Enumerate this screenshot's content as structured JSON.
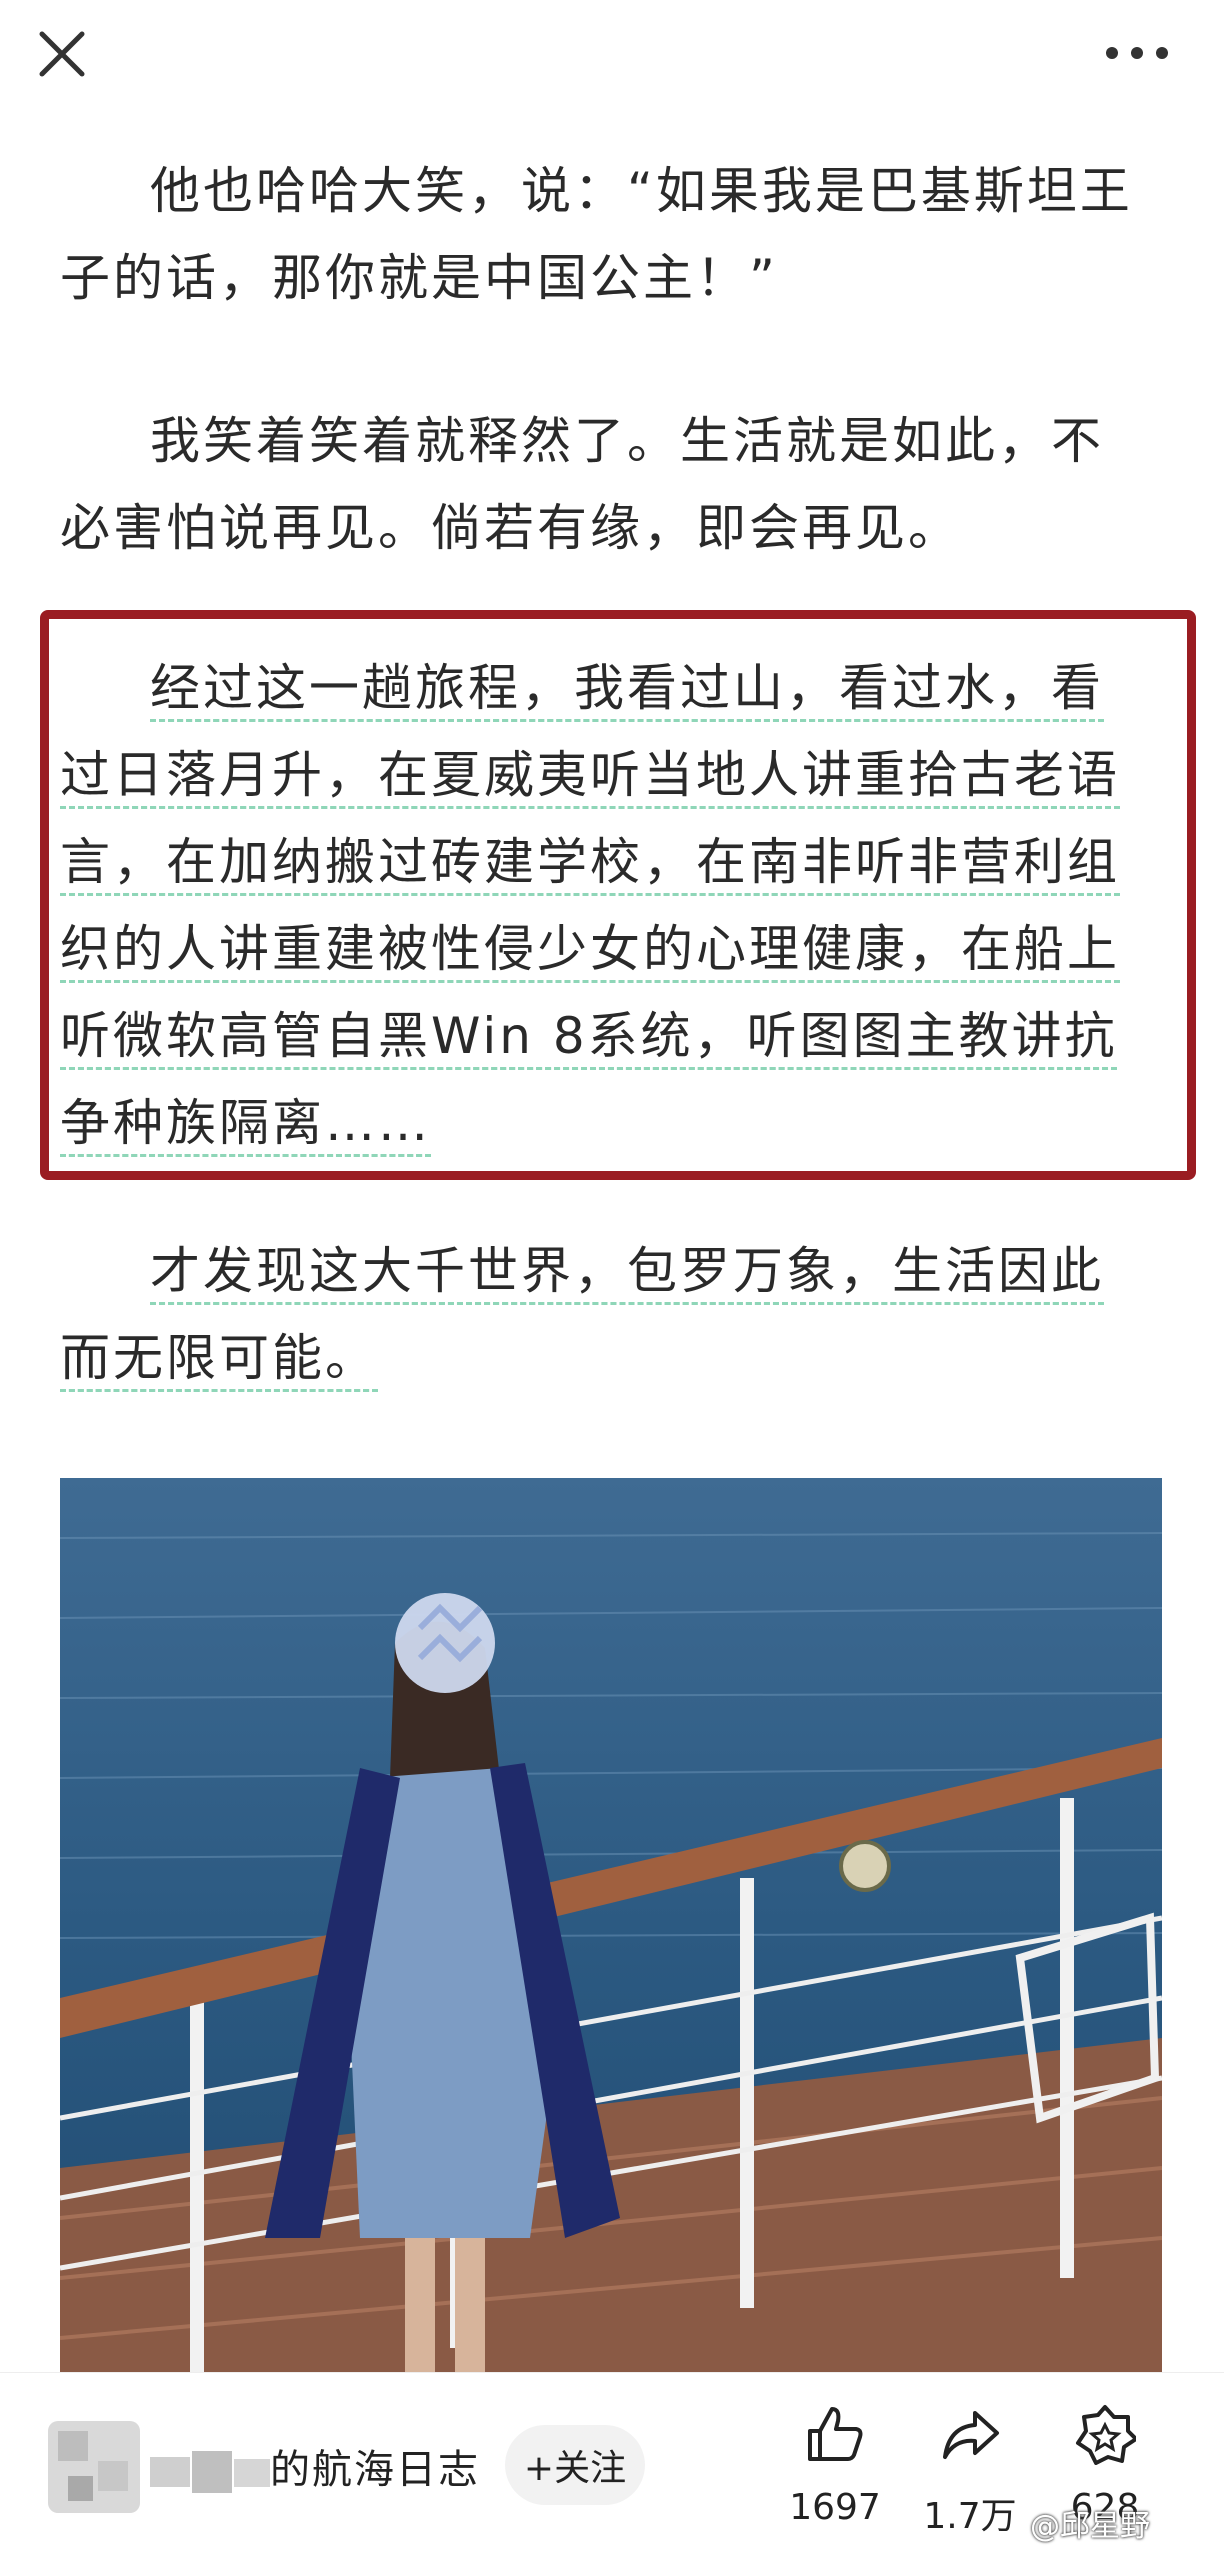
{
  "header": {
    "close_icon": "close-icon",
    "more_icon": "more-icon"
  },
  "article": {
    "para1": {
      "line1": "他也哈哈大笑，说：“如果我是巴基斯坦王",
      "line2": "子的话，那你就是中国公主！”"
    },
    "para2": {
      "line1": "我笑着笑着就释然了。生活就是如此，不",
      "line2": "必害怕说再见。倘若有缘，即会再见。"
    },
    "para3": {
      "line1": "经过这一趟旅程，我看过山，看过水，看",
      "line2": "过日落月升，在夏威夷听当地人讲重拾古老语",
      "line3": "言，在加纳搬过砖建学校，在南非听非营利组",
      "line4": "织的人讲重建被性侵少女的心理健康，在船上",
      "line5": "听微软高管自黑Win 8系统，听图图主教讲抗",
      "line6": "争种族隔离……"
    },
    "para4": {
      "line1": "才发现这大千世界，包罗万象，生活因此",
      "line2": "而无限可能。"
    }
  },
  "colors": {
    "highlight_border": "#9a1c22",
    "dashed_underline": "#8fd6b8"
  },
  "bottom_bar": {
    "author_name": "的航海日志",
    "follow_label": "+关注",
    "like_count": "1697",
    "share_count": "1.7万",
    "collect_count": "628",
    "watermark": "@邱星野"
  }
}
